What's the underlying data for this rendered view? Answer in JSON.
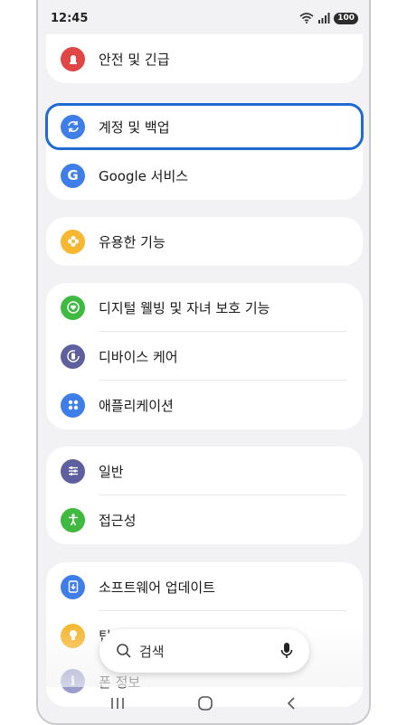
{
  "status_bar": {
    "time": "12:45",
    "battery": "100"
  },
  "settings": {
    "safety": "안전 및 긴급",
    "accounts": "계정 및 백업",
    "google": "Google 서비스",
    "useful": "유용한 기능",
    "digital": "디지털 웰빙 및 자녀 보호 기능",
    "device_care": "디바이스 케어",
    "apps": "애플리케이션",
    "general": "일반",
    "accessibility": "접근성",
    "software_update": "소프트웨어 업데이트",
    "tips_partial": "팁",
    "about": "폰 정보"
  },
  "search": {
    "placeholder": "검색"
  },
  "colors": {
    "red": "#e04646",
    "blue": "#3f7ee8",
    "yellow": "#f7b730",
    "green": "#3fb93f",
    "purple": "#5d5f9e",
    "highlight": "#1f6bd1"
  }
}
